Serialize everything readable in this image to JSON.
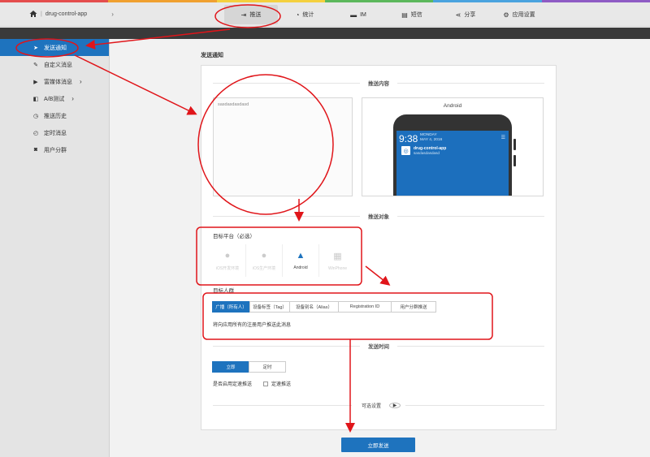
{
  "rainbow_colors": [
    "#e44d4d",
    "#f0a030",
    "#f4d03f",
    "#5cb85c",
    "#4aa3df",
    "#8e5bc4"
  ],
  "accent": "#1e73be",
  "annotation_color": "#e0151a",
  "header": {
    "app_name": "drug-control-app",
    "separator": "|",
    "nav": [
      {
        "label": "推送",
        "icon": "push-icon",
        "active": true
      },
      {
        "label": "统计",
        "icon": "stats-icon"
      },
      {
        "label": "IM",
        "icon": "im-icon"
      },
      {
        "label": "短信",
        "icon": "sms-icon"
      },
      {
        "label": "分享",
        "icon": "share-icon"
      },
      {
        "label": "应用设置",
        "icon": "gear-icon"
      }
    ]
  },
  "sidebar": {
    "items": [
      {
        "label": "发送通知",
        "icon": "send-icon",
        "active": true
      },
      {
        "label": "自定义消息",
        "icon": "edit-icon"
      },
      {
        "label": "富媒体消息",
        "icon": "media-icon",
        "chevron": true
      },
      {
        "label": "A/B测试",
        "icon": "ab-icon",
        "chevron": true
      },
      {
        "label": "推送历史",
        "icon": "history-icon"
      },
      {
        "label": "定时消息",
        "icon": "clock-icon"
      },
      {
        "label": "用户分群",
        "icon": "users-icon"
      }
    ]
  },
  "main": {
    "page_title": "发送通知",
    "content_section": "推送内容",
    "message_text": "sasdasdasdasd",
    "preview": {
      "label": "Android",
      "time": "9:38",
      "day": "MONDAY",
      "date": "MAY 4, 2016",
      "notif_title": "drug-control-app",
      "notif_body": "sasdasdasdasd"
    },
    "target_section": "推送对象",
    "platform_label": "目标平台（必选）",
    "platforms": [
      {
        "label": "iOS开发环境",
        "enabled": false
      },
      {
        "label": "iOS生产环境",
        "enabled": false
      },
      {
        "label": "Android",
        "enabled": true
      },
      {
        "label": "WinPhone",
        "enabled": false
      }
    ],
    "audience_label": "目标人群",
    "audience_tabs": [
      {
        "label": "广播（所有人）",
        "active": true
      },
      {
        "label": "设备标签（Tag）"
      },
      {
        "label": "设备别名（Alias）"
      },
      {
        "label": "Registration ID"
      },
      {
        "label": "用户分群推送"
      }
    ],
    "audience_desc": "将向应用所有的注册用户推送此消息",
    "time_section": "发送时间",
    "time_options": [
      {
        "label": "立即",
        "active": true
      },
      {
        "label": "定时"
      }
    ],
    "fast_label": "是否启用定速推送",
    "fast_checkbox": "定速推送",
    "optional_label": "可选设置",
    "submit_label": "立即发送"
  }
}
